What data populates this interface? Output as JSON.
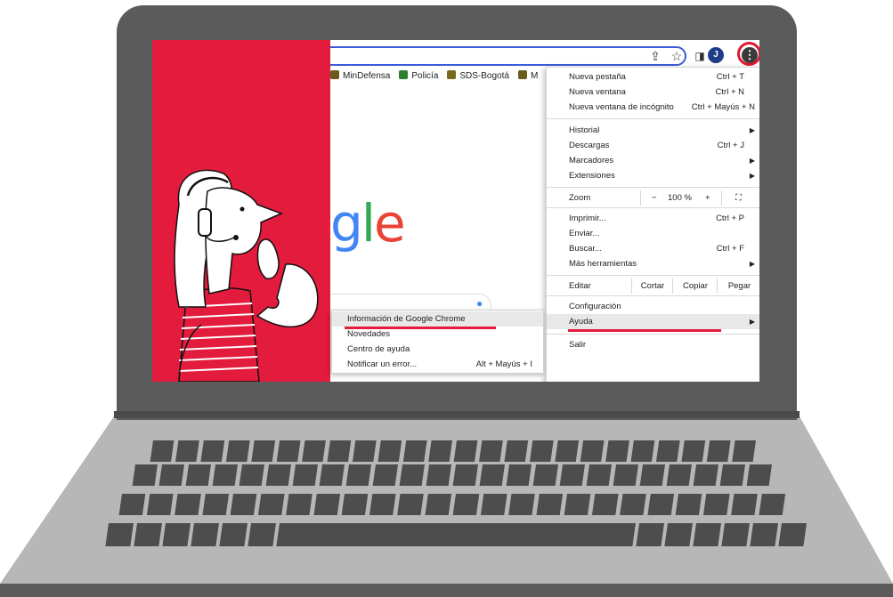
{
  "colors": {
    "accent_red": "#e31b3c",
    "laptop_frame": "#5b5b5b",
    "laptop_base": "#b7b7b7",
    "key": "#4d4d4d",
    "avatar": "#1f3c88"
  },
  "toolbar": {
    "share_icon": "share-icon",
    "star_icon": "star-icon",
    "sidepanel_icon": "side-panel-icon",
    "avatar_initial": "J",
    "menu_glyph": "⋮"
  },
  "bookmarks": [
    {
      "label": "MinDefensa",
      "color": "#6b5a1e"
    },
    {
      "label": "Policía",
      "color": "#2e7d32"
    },
    {
      "label": "SDS-Bogotá",
      "color": "#7a6a1b"
    },
    {
      "label": "M",
      "color": "#6b5a1e"
    }
  ],
  "logo_text": "gle",
  "menu": {
    "new_tab": {
      "label": "Nueva pestaña",
      "shortcut": "Ctrl + T"
    },
    "new_window": {
      "label": "Nueva ventana",
      "shortcut": "Ctrl + N"
    },
    "incognito": {
      "label": "Nueva ventana de incógnito",
      "shortcut": "Ctrl + Mayús + N"
    },
    "history": {
      "label": "Historial"
    },
    "downloads": {
      "label": "Descargas",
      "shortcut": "Ctrl + J"
    },
    "bookmarks": {
      "label": "Marcadores"
    },
    "extensions": {
      "label": "Extensiones"
    },
    "zoom": {
      "label": "Zoom",
      "minus": "−",
      "value": "100 %",
      "plus": "+",
      "fullscreen": "⛶"
    },
    "print": {
      "label": "Imprimir...",
      "shortcut": "Ctrl + P"
    },
    "cast": {
      "label": "Enviar..."
    },
    "find": {
      "label": "Buscar...",
      "shortcut": "Ctrl + F"
    },
    "more_tools": {
      "label": "Más herramientas"
    },
    "edit": {
      "label": "Editar",
      "cut": "Cortar",
      "copy": "Copiar",
      "paste": "Pegar"
    },
    "settings": {
      "label": "Configuración"
    },
    "help": {
      "label": "Ayuda"
    },
    "exit": {
      "label": "Salir"
    }
  },
  "submenu": {
    "about": "Información de Google Chrome",
    "whats_new": "Novedades",
    "help_center": "Centro de ayuda",
    "report": {
      "label": "Notificar un error...",
      "shortcut": "Alt + Mayús + I"
    }
  }
}
